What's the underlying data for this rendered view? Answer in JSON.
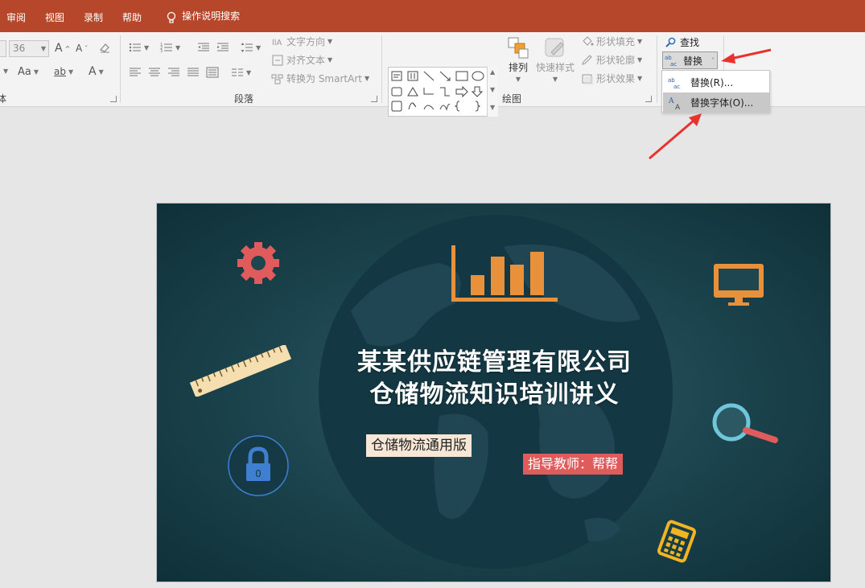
{
  "menu": {
    "tabs": [
      "审阅",
      "视图",
      "录制",
      "帮助"
    ],
    "tellme": "操作说明搜索"
  },
  "ribbon": {
    "font_group": {
      "size_value": "36",
      "label": "体",
      "case_label": "Aa"
    },
    "paragraph_group": {
      "label": "段落",
      "text_direction": "文字方向",
      "align_text": "对齐文本",
      "smartart": "转换为 SmartArt"
    },
    "drawing_group": {
      "label": "绘图",
      "arrange": "排列",
      "quick_styles": "快速样式",
      "shape_fill": "形状填充",
      "shape_outline": "形状轮廓",
      "shape_effects": "形状效果"
    },
    "editing_group": {
      "find": "查找",
      "replace": "替换"
    },
    "replace_menu": [
      {
        "label": "替换(R)..."
      },
      {
        "label": "替换字体(O)..."
      }
    ]
  },
  "slide": {
    "title_line1": "某某供应链管理有限公司",
    "title_line2": "仓储物流知识培训讲义",
    "subtitle": "仓储物流通用版",
    "teacher": "指导教师：帮帮"
  },
  "colors": {
    "menubar": "#b7472a",
    "arrow": "#e8322e",
    "slide_bg": "#1d4650",
    "gear": "#e05c5c",
    "chart": "#e8913a",
    "ruler": "#f5dfb0",
    "lock": "#3e7fd1",
    "magnifier": "#6ec6d8",
    "calculator": "#f2b420"
  },
  "icons": [
    "lightbulb-icon",
    "gear-icon",
    "bar-chart-icon",
    "monitor-icon",
    "ruler-icon",
    "magnifier-icon",
    "lock-icon",
    "calculator-icon"
  ]
}
